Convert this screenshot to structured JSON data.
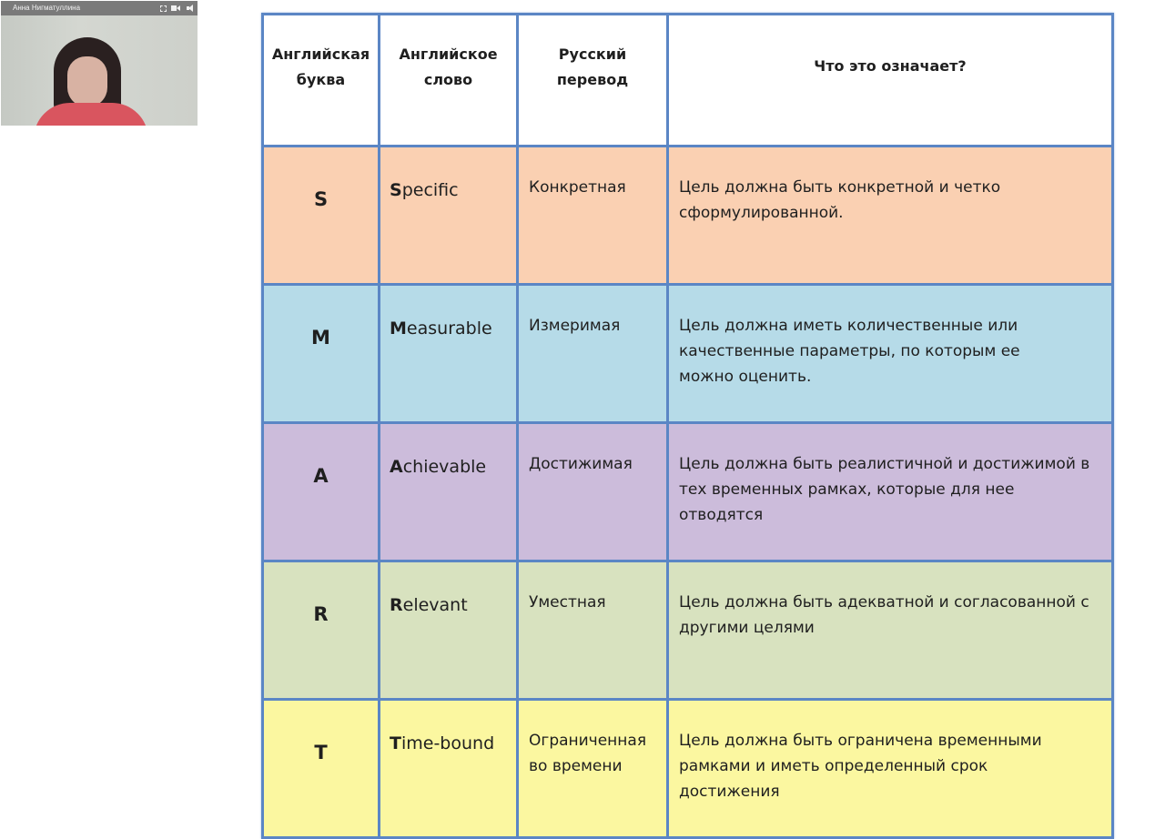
{
  "webcam": {
    "presenter_name": "Анна Нигматуллина",
    "icons": [
      "fullscreen-icon",
      "camera-icon",
      "volume-icon"
    ]
  },
  "table": {
    "headers": {
      "letter": "Английская буква",
      "word": "Английское слово",
      "ru": "Русский перевод",
      "meaning": "Что это означает?"
    },
    "rows": [
      {
        "letter": "S",
        "word_first": "S",
        "word_rest": "pecific",
        "ru": "Конкретная",
        "meaning": "Цель должна быть конкретной и четко сформулированной.",
        "color": "#fad0b2"
      },
      {
        "letter": "M",
        "word_first": "M",
        "word_rest": "easurable",
        "ru": "Измеримая",
        "meaning": "Цель должна иметь  количественные или качественные  параметры, по которым ее можно оценить.",
        "color": "#b6dbe8"
      },
      {
        "letter": "A",
        "word_first": "A",
        "word_rest": "chievable",
        "ru": "Достижимая",
        "meaning": "Цель должна быть реалистичной и достижимой в тех временных рамках, которые для нее отводятся",
        "color": "#ccbcdb"
      },
      {
        "letter": "R",
        "word_first": "R",
        "word_rest": "elevant",
        "ru": "Уместная",
        "meaning": "Цель должна быть адекватной и согласованной с другими целями",
        "color": "#d8e2bf"
      },
      {
        "letter": "T",
        "word_first": "T",
        "word_rest": "ime-bound",
        "ru": "Ограниченная во времени",
        "meaning": "Цель должна быть ограничена  временными рамками и иметь определенный срок достижения",
        "color": "#fbf7a0"
      }
    ]
  },
  "colors": {
    "table_border": "#5b86c5",
    "header_bg": "#ffffff"
  }
}
